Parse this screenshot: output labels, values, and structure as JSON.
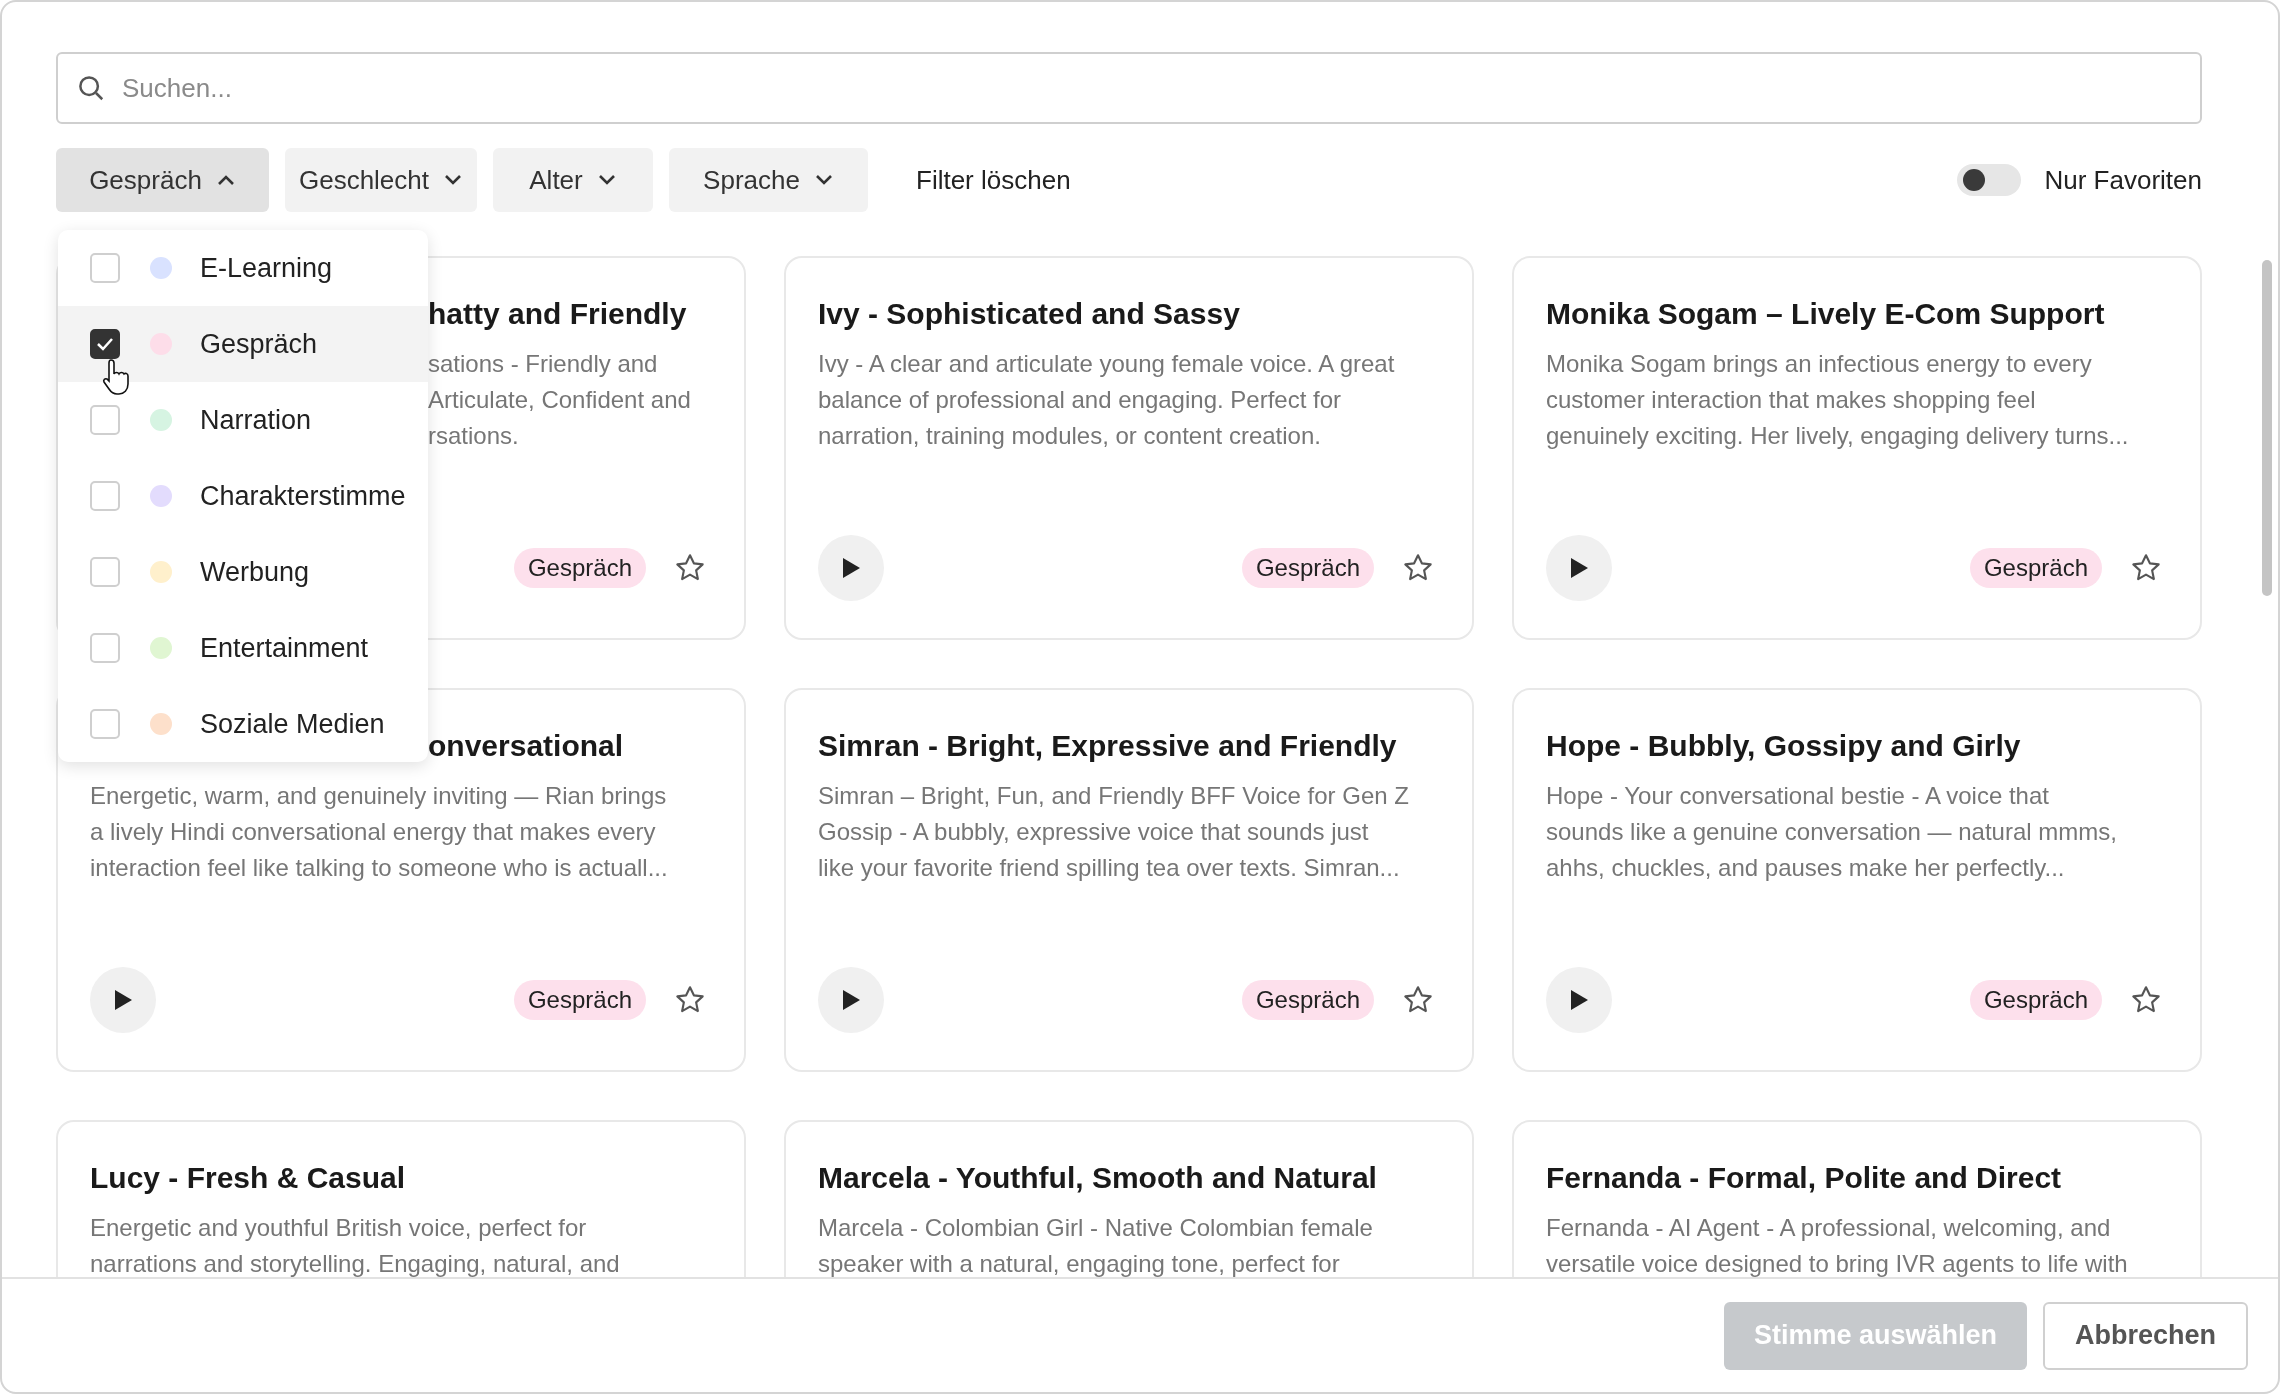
{
  "search": {
    "placeholder": "Suchen..."
  },
  "filters": [
    {
      "label": "Gespräch",
      "expanded": true
    },
    {
      "label": "Geschlecht",
      "expanded": false
    },
    {
      "label": "Alter",
      "expanded": false
    },
    {
      "label": "Sprache",
      "expanded": false
    }
  ],
  "clear_filters": "Filter löschen",
  "favorites_toggle": {
    "label": "Nur Favoriten",
    "on": false
  },
  "dropdown": [
    {
      "label": "E-Learning",
      "checked": false,
      "hovered": false,
      "color": "#d9e2ff"
    },
    {
      "label": "Gespräch",
      "checked": true,
      "hovered": true,
      "color": "#fddde9"
    },
    {
      "label": "Narration",
      "checked": false,
      "hovered": false,
      "color": "#d6f4e2"
    },
    {
      "label": "Charakterstimme",
      "checked": false,
      "hovered": false,
      "color": "#e3dcfd"
    },
    {
      "label": "Werbung",
      "checked": false,
      "hovered": false,
      "color": "#fff0cc"
    },
    {
      "label": "Entertainment",
      "checked": false,
      "hovered": false,
      "color": "#e0f6d2"
    },
    {
      "label": "Soziale Medien",
      "checked": false,
      "hovered": false,
      "color": "#fde0cb"
    }
  ],
  "cards": [
    {
      "title_covered": true,
      "text_covered": true,
      "title": "hatty and Friendly",
      "description_lines": [
        "sations - Friendly and",
        "Articulate, Confident and",
        "rsations."
      ],
      "tag": "Gespräch",
      "favorite": false
    },
    {
      "title": "Ivy - Sophisticated and Sassy",
      "description_lines": [
        "Ivy - A clear and articulate young female voice. A great",
        "balance of professional and engaging. Perfect for",
        "narration, training modules, or content creation."
      ],
      "tag": "Gespräch",
      "favorite": false
    },
    {
      "title": "Monika Sogam – Lively E-Com Support",
      "description_lines": [
        "Monika Sogam brings an infectious energy to every",
        "customer interaction that makes shopping feel",
        "genuinely exciting. Her lively, engaging delivery turns..."
      ],
      "tag": "Gespräch",
      "favorite": false
    },
    {
      "title_covered": true,
      "text_covered": false,
      "title": "onversational",
      "description_lines": [
        "Energetic, warm, and genuinely inviting — Rian brings",
        "a lively Hindi conversational energy that makes every",
        "interaction feel like talking to someone who is actuall..."
      ],
      "tag": "Gespräch",
      "favorite": false
    },
    {
      "title": "Simran - Bright, Expressive and Friendly",
      "description_lines": [
        "Simran – Bright, Fun, and Friendly BFF Voice for Gen Z",
        "Gossip - A bubbly, expressive voice that sounds just",
        "like your favorite friend spilling tea over texts. Simran..."
      ],
      "tag": "Gespräch",
      "favorite": false
    },
    {
      "title": "Hope - Bubbly, Gossipy and Girly",
      "description_lines": [
        "Hope - Your conversational bestie - A voice that",
        "sounds like a genuine conversation — natural mmms,",
        "ahhs, chuckles, and pauses make her perfectly..."
      ],
      "tag": "Gespräch",
      "favorite": false
    },
    {
      "title": "Lucy - Fresh & Casual",
      "description_lines": [
        "Energetic and youthful British voice, perfect for",
        "narrations and storytelling. Engaging, natural, and"
      ]
    },
    {
      "title": "Marcela - Youthful, Smooth and Natural",
      "description_lines": [
        "Marcela - Colombian Girl - Native Colombian female",
        "speaker with a natural, engaging tone, perfect for"
      ]
    },
    {
      "title": "Fernanda - Formal, Polite and Direct",
      "description_lines": [
        "Fernanda - AI Agent - A professional, welcoming, and",
        "versatile voice designed to bring IVR agents to life with"
      ]
    }
  ],
  "footer": {
    "primary": {
      "label": "Stimme auswählen",
      "disabled": true
    },
    "cancel": "Abbrechen"
  }
}
